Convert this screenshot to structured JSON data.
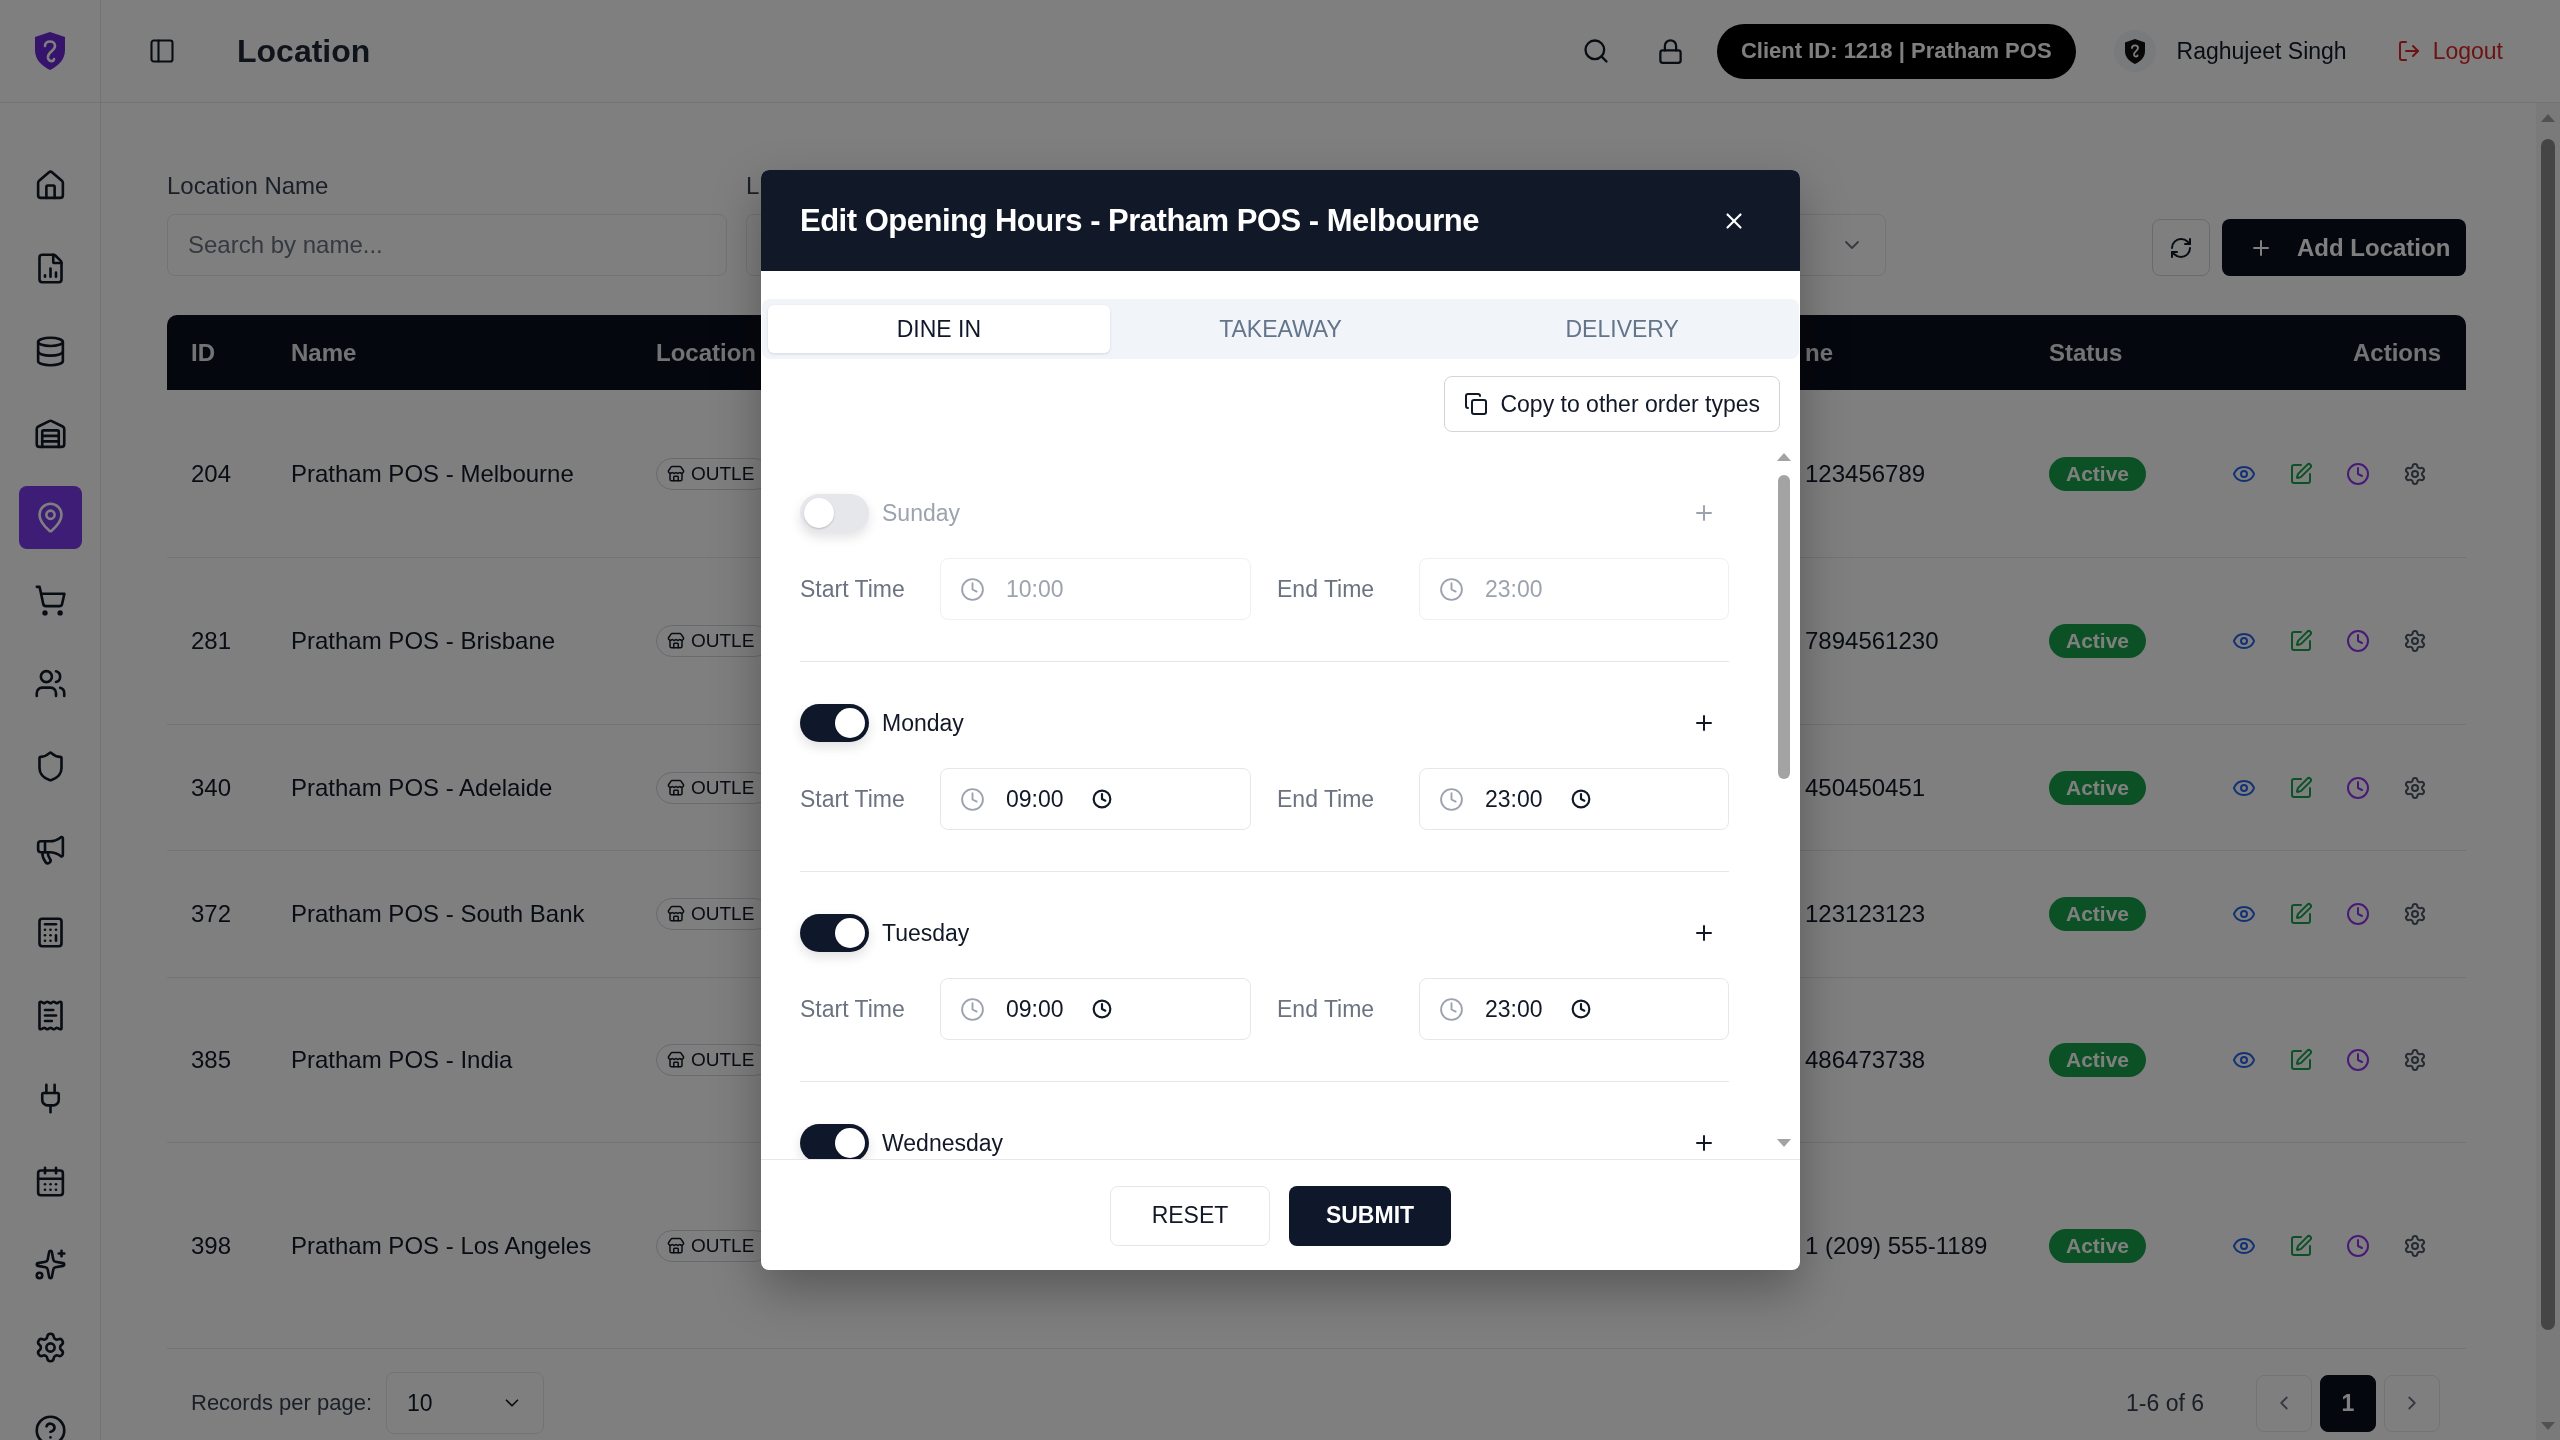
{
  "sidebar": {
    "items": [
      {
        "selected": false
      },
      {
        "selected": false
      },
      {
        "selected": false
      },
      {
        "selected": false
      },
      {
        "selected": true
      },
      {
        "selected": false
      },
      {
        "selected": false
      },
      {
        "selected": false
      },
      {
        "selected": false
      },
      {
        "selected": false
      },
      {
        "selected": false
      },
      {
        "selected": false
      },
      {
        "selected": false
      },
      {
        "selected": false
      },
      {
        "selected": false
      },
      {
        "selected": false
      }
    ]
  },
  "header": {
    "title": "Location",
    "client_badge": "Client ID: 1218 | Pratham POS",
    "user_name": "Raghujeet Singh",
    "logout": "Logout"
  },
  "filters": {
    "name_label": "Location Name",
    "name_placeholder": "Search by name...",
    "type_label": "L"
  },
  "toolbar": {
    "add_button": "Add Location"
  },
  "table": {
    "columns": [
      "ID",
      "Name",
      "Location",
      "ne",
      "Status",
      "Actions"
    ],
    "rows": [
      {
        "id": "204",
        "name": "Pratham POS - Melbourne",
        "location_type": "OUTLE",
        "phone": "123456789",
        "status": "Active"
      },
      {
        "id": "281",
        "name": "Pratham POS - Brisbane",
        "location_type": "OUTLE",
        "phone": "7894561230",
        "status": "Active"
      },
      {
        "id": "340",
        "name": "Pratham POS - Adelaide",
        "location_type": "OUTLE",
        "phone": "450450451",
        "status": "Active"
      },
      {
        "id": "372",
        "name": "Pratham POS - South Bank",
        "location_type": "OUTLE",
        "phone": "123123123",
        "status": "Active"
      },
      {
        "id": "385",
        "name": "Pratham POS - India",
        "location_type": "OUTLE",
        "phone": "486473738",
        "status": "Active"
      },
      {
        "id": "398",
        "name": "Pratham POS - Los Angeles",
        "location_type": "OUTLE",
        "phone": "1 (209) 555-1189",
        "status": "Active"
      }
    ]
  },
  "pagination": {
    "records_label": "Records per page:",
    "per_page": "10",
    "range": "1-6 of 6",
    "pages": [
      {
        "label": "1",
        "selected": true
      }
    ]
  },
  "modal": {
    "title": "Edit Opening Hours - Pratham POS - Melbourne",
    "tabs": [
      {
        "label": "DINE IN",
        "selected": true
      },
      {
        "label": "TAKEAWAY",
        "selected": false
      },
      {
        "label": "DELIVERY",
        "selected": false
      }
    ],
    "copy_button": "Copy to other order types",
    "days": [
      {
        "name": "Sunday",
        "on": false,
        "start_label": "Start Time",
        "start": "10:00",
        "end_label": "End Time",
        "end": "23:00"
      },
      {
        "name": "Monday",
        "on": true,
        "start_label": "Start Time",
        "start": "09:00",
        "end_label": "End Time",
        "end": "23:00"
      },
      {
        "name": "Tuesday",
        "on": true,
        "start_label": "Start Time",
        "start": "09:00",
        "end_label": "End Time",
        "end": "23:00"
      },
      {
        "name": "Wednesday",
        "on": true
      }
    ],
    "reset_button": "RESET",
    "submit_button": "SUBMIT"
  }
}
